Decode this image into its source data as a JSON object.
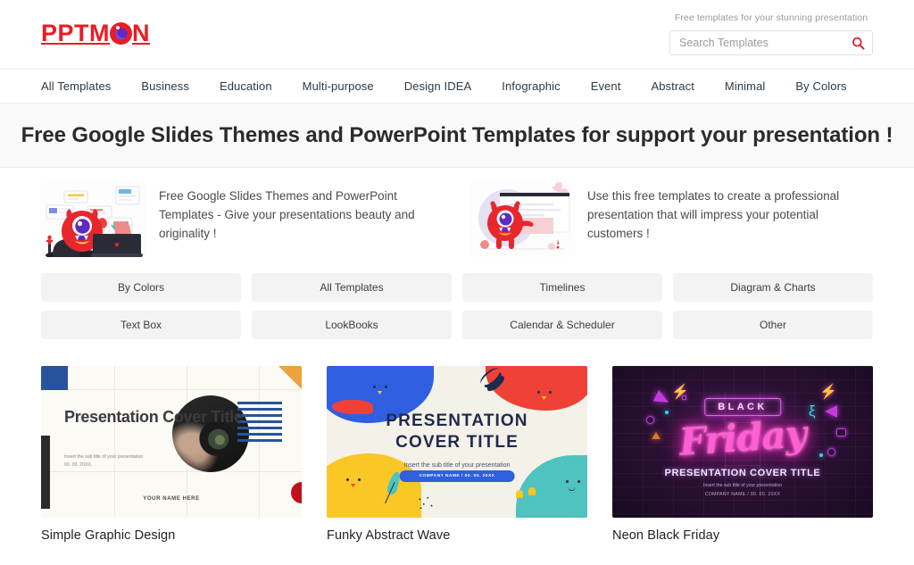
{
  "site": {
    "logo_text_left": "PPTM",
    "logo_text_right": "N",
    "logo_color": "#ea1c24"
  },
  "header": {
    "tagline": "Free templates for your stunning presentation",
    "search": {
      "placeholder": "Search Templates",
      "value": "",
      "icon": "search-icon",
      "icon_color": "#e01f26"
    }
  },
  "nav": {
    "items": [
      {
        "label": "All Templates"
      },
      {
        "label": "Business"
      },
      {
        "label": "Education"
      },
      {
        "label": "Multi-purpose"
      },
      {
        "label": "Design IDEA"
      },
      {
        "label": "Infographic"
      },
      {
        "label": "Event"
      },
      {
        "label": "Abstract"
      },
      {
        "label": "Minimal"
      },
      {
        "label": "By Colors"
      }
    ]
  },
  "hero": {
    "title": "Free Google Slides Themes and PowerPoint Templates for support your presentation !"
  },
  "intro": {
    "blocks": [
      {
        "art": "monster-at-laptop-illustration",
        "text": "Free Google Slides Themes and PowerPoint Templates - Give your presentations beauty and originality !"
      },
      {
        "art": "monster-presenting-illustration",
        "text": "Use this free templates to create a professional presentation that will impress your potential customers !"
      }
    ]
  },
  "categories": [
    {
      "label": "By Colors"
    },
    {
      "label": "All Templates"
    },
    {
      "label": "Timelines"
    },
    {
      "label": "Diagram & Charts"
    },
    {
      "label": "Text Box"
    },
    {
      "label": "LookBooks"
    },
    {
      "label": "Calendar & Scheduler"
    },
    {
      "label": "Other"
    }
  ],
  "templates": [
    {
      "title": "Simple Graphic Design",
      "slide": {
        "heading": "Presentation Cover Title",
        "subtitle": "Insert the sub title of your presentation",
        "date": "00. 00. 20XX.",
        "footer": "YOUR NAME HERE"
      }
    },
    {
      "title": "Funky Abstract Wave",
      "slide": {
        "heading_line1": "PRESENTATION",
        "heading_line2": "COVER TITLE",
        "subtitle": "Insert the sub title of your presentation",
        "button": "COMPANY NAME  /  00. 00. 20XX"
      }
    },
    {
      "title": "Neon Black Friday",
      "slide": {
        "badge": "BLACK",
        "script": "Friday",
        "heading": "PRESENTATION COVER TITLE",
        "subtitle": "Insert the sub title of your presentation",
        "company": "COMPANY NAME  /  00. 00. 20XX"
      }
    }
  ]
}
